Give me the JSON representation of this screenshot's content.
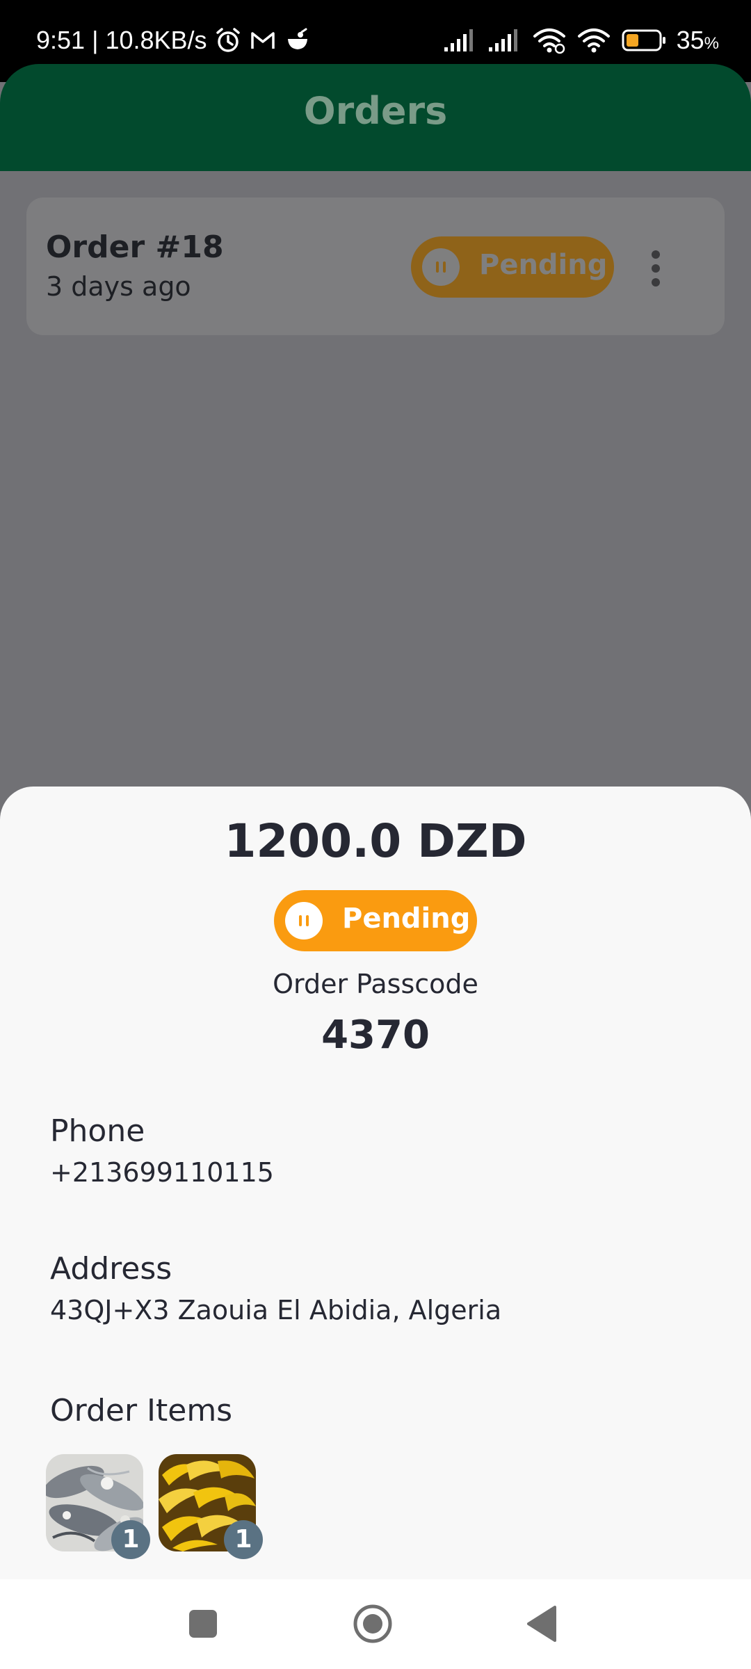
{
  "status_bar": {
    "time": "9:51",
    "network_speed": "10.8KB/s",
    "battery_percent": "35",
    "battery_unit": "%"
  },
  "header": {
    "title": "Orders"
  },
  "order_card": {
    "title": "Order #18",
    "time_ago": "3 days ago",
    "status_label": "Pending",
    "menu_icon": "more-vertical-icon"
  },
  "sheet": {
    "amount": "1200.0 DZD",
    "status_label": "Pending",
    "passcode_label": "Order Passcode",
    "passcode_value": "4370",
    "phone_label": "Phone",
    "phone_value": "+213699110115",
    "address_label": "Address",
    "address_value": "43QJ+X3 Zaouia El Abidia, Algeria",
    "items_label": "Order Items",
    "items": [
      {
        "image": "fish",
        "quantity": "1"
      },
      {
        "image": "bananas",
        "quantity": "1"
      }
    ]
  },
  "nav_bar": {
    "buttons": [
      "square-recents-icon",
      "circle-home-icon",
      "triangle-back-icon"
    ]
  },
  "colors": {
    "header_bg": "#024a2d",
    "pending": "#fa9b10",
    "scrim": "#717175",
    "sheet_bg": "#f8f8f8",
    "text_dark": "#262833",
    "quantity_badge": "#5a7283"
  }
}
